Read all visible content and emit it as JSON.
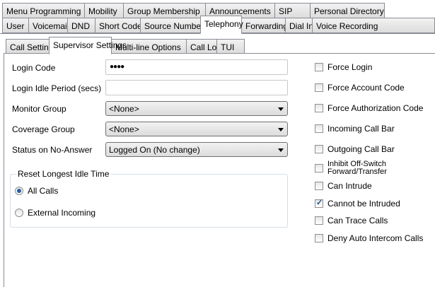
{
  "tabs_row1": [
    "Menu Programming",
    "Mobility",
    "Group Membership",
    "Announcements",
    "SIP",
    "Personal Directory"
  ],
  "tabs_row2": [
    "User",
    "Voicemail",
    "DND",
    "Short Codes",
    "Source Numbers",
    "Telephony",
    "Forwarding",
    "Dial In",
    "Voice Recording"
  ],
  "active_tab": "Telephony",
  "subtabs": [
    "Call Settings",
    "Supervisor Settings",
    "Multi-line Options",
    "Call Log",
    "TUI"
  ],
  "active_subtab": "Supervisor Settings",
  "fields": {
    "login_code": {
      "label": "Login Code",
      "value": "●●●●"
    },
    "login_idle": {
      "label": "Login Idle Period (secs)",
      "value": ""
    },
    "monitor_group": {
      "label": "Monitor Group",
      "value": "<None>"
    },
    "coverage_group": {
      "label": "Coverage Group",
      "value": "<None>"
    },
    "status_no_answer": {
      "label": "Status on No-Answer",
      "value": "Logged On (No change)"
    }
  },
  "reset_group": {
    "title": "Reset Longest Idle Time",
    "options": [
      "All Calls",
      "External Incoming"
    ],
    "selected": "All Calls"
  },
  "checkboxes": [
    {
      "label": "Force Login",
      "checked": false
    },
    {
      "label": "Force Account Code",
      "checked": false
    },
    {
      "label": "Force Authorization Code",
      "checked": false
    },
    {
      "label": "Incoming Call Bar",
      "checked": false
    },
    {
      "label": "Outgoing Call Bar",
      "checked": false
    },
    {
      "label": "Inhibit Off-Switch Forward/Transfer",
      "checked": false
    },
    {
      "label": "Can Intrude",
      "checked": false
    },
    {
      "label": "Cannot be Intruded",
      "checked": true
    },
    {
      "label": "Can Trace Calls",
      "checked": false
    },
    {
      "label": "Deny Auto Intercom Calls",
      "checked": false
    }
  ]
}
